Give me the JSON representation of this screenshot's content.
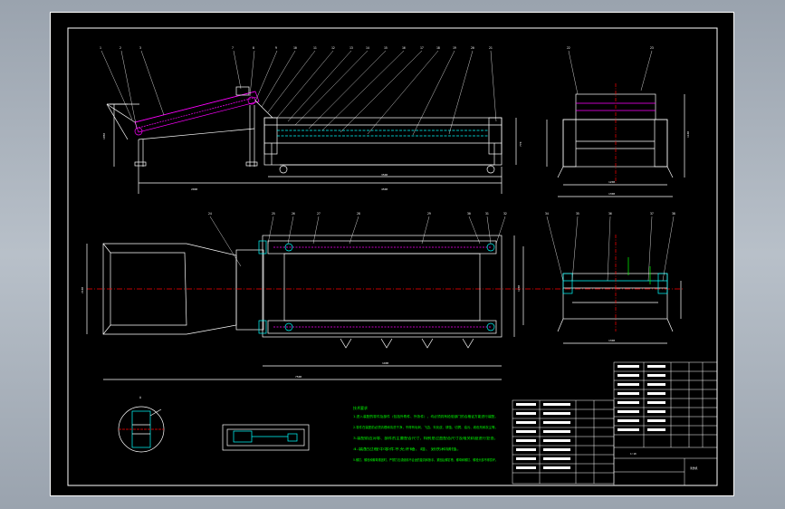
{
  "sheet": {
    "background": "#000000",
    "line_color": "#ffffff",
    "accent_magenta": "#ff00ff",
    "accent_green": "#00ff00",
    "accent_cyan": "#00ffff",
    "centerline_red": "#ff0000"
  },
  "balloons_top": [
    "1",
    "2",
    "3",
    "7",
    "8",
    "9",
    "10",
    "11",
    "12",
    "13",
    "14",
    "15",
    "16",
    "17",
    "18",
    "19",
    "20",
    "21"
  ],
  "balloons_side": [
    "22",
    "23"
  ],
  "balloons_plan": [
    "24",
    "25",
    "26",
    "27",
    "28",
    "29",
    "30",
    "31",
    "32",
    "33"
  ],
  "balloons_plan_side": [
    "34",
    "35",
    "36",
    "37",
    "38"
  ],
  "dims": {
    "front_len": "4500",
    "front_sub1": "3500",
    "front_sub2": "2000",
    "front_h1": "1050",
    "front_h2": "770",
    "side_w1": "1200",
    "side_w2": "1300",
    "side_h": "1100",
    "plan_len": "7500",
    "plan_w1": "2100",
    "plan_w2": "1200",
    "plan_w3": "1400",
    "plan_side_w": "1300",
    "detail_a": "A"
  },
  "notes": {
    "title": "技术要求",
    "lines": [
      "1.进入装配的零件及部件（包括外购件、外协件），均必须具有检验部门的合格证方能进行装配。",
      "2.零件在装配前必须清理和清洗干净，不得有毛刺、飞边、氧化皮、锈蚀、切屑、油污、着色剂和灰尘等。",
      "3.装配前应对零、部件的主要配合尺寸，特别是过盈配合尺寸及相关精度进行复查。",
      "4.装配过程中零件不允许磕、碰、划伤和锈蚀。",
      "5.螺钉、螺栓和螺母紧固时，严禁打击或使用不合适的旋具和扳手。紧固后螺钉槽、螺母和螺钉、螺栓头部不得损坏。"
    ]
  },
  "title_block": {
    "drawing_name": "清洗机",
    "scale": "1:10"
  }
}
